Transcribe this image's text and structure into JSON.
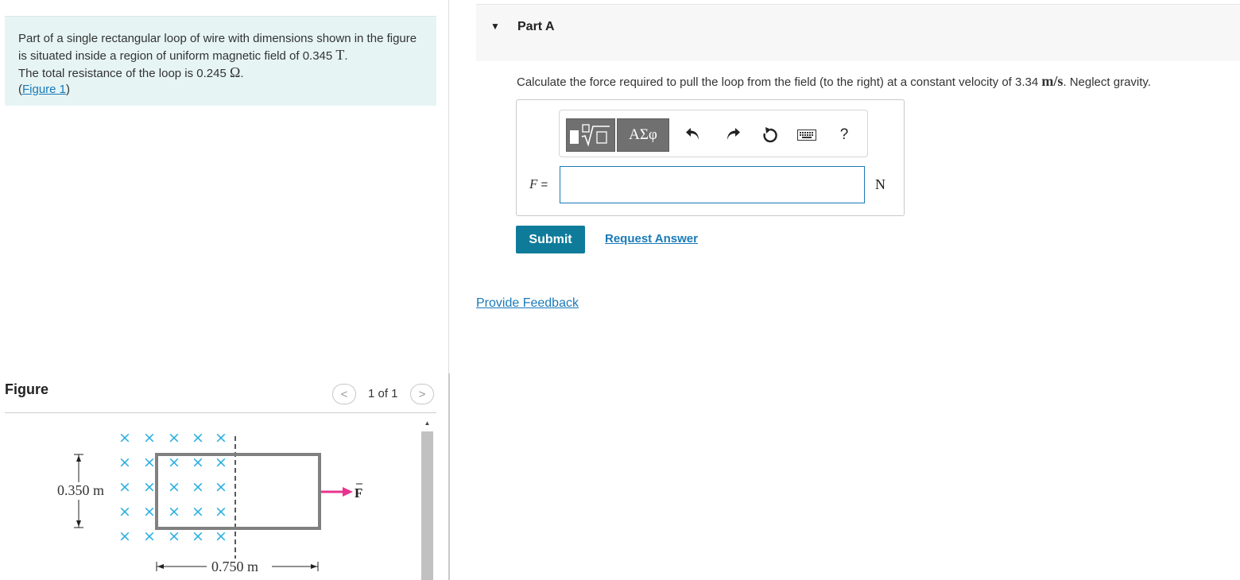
{
  "intro": {
    "text1": "Part of a single rectangular loop of wire with dimensions shown in the figure is situated inside a region of uniform magnetic field of 0.345 ",
    "field_unit": "T",
    "text2": "The total resistance of the loop is 0.245 ",
    "resistance_unit": "Ω",
    "period": ".",
    "figure_link_open": "(",
    "figure_link": "Figure 1",
    "figure_link_close": ")"
  },
  "figure_panel": {
    "title": "Figure",
    "prev_icon": "chevron-left-icon",
    "next_icon": "chevron-right-icon",
    "pager": "1 of 1",
    "diagram": {
      "height_label": "0.350 m",
      "width_label": "0.750 m",
      "force_label": "F",
      "field_symbol": "×",
      "field_color": "#29aee0",
      "force_arrow_color": "#e8338e",
      "loop_color": "#808080"
    }
  },
  "part": {
    "caret_icon": "caret-down-icon",
    "title": "Part A",
    "question_prefix": "Calculate the force required to pull the loop from the field (to the right) at a constant velocity of 3.34 ",
    "velocity_unit": "m/s",
    "question_suffix": ". Neglect gravity."
  },
  "toolbar": {
    "template_icon": "fraction-root-template-icon",
    "greek_label": "ΑΣφ",
    "undo_icon": "undo-icon",
    "redo_icon": "redo-icon",
    "reset_icon": "reset-icon",
    "keyboard_icon": "keyboard-icon",
    "help_label": "?"
  },
  "answer": {
    "variable": "F",
    "equals": " =",
    "value": "",
    "unit": "N"
  },
  "actions": {
    "submit_label": "Submit",
    "request_label": "Request Answer",
    "feedback_label": "Provide Feedback"
  }
}
